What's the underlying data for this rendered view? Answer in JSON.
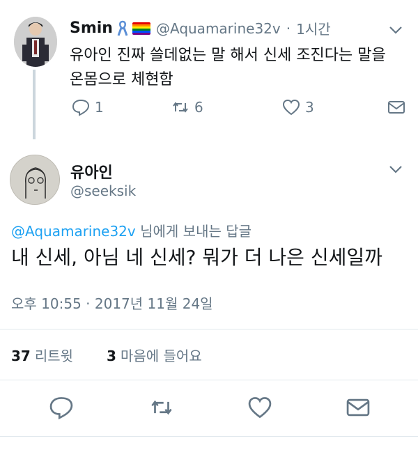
{
  "parent_tweet": {
    "display_name": "Smin",
    "handle": "@Aquamarine32v",
    "separator": "·",
    "time": "1시간",
    "text": "유아인 진짜 쓸데없는 말 해서 신세 조진다는 말을 온몸으로 체현함",
    "reply_count": "1",
    "retweet_count": "6",
    "like_count": "3",
    "icons": [
      "reply-icon",
      "retweet-icon",
      "like-icon",
      "message-icon",
      "chevron-down-icon",
      "ribbon-icon",
      "rainbow-flag-icon"
    ]
  },
  "main_tweet": {
    "display_name": "유아인",
    "handle": "@seeksik",
    "reply_to_handle": "@Aquamarine32v",
    "reply_to_suffix": " 님에게 보내는 답글",
    "text": "내 신세, 아님 네 신세? 뭐가 더 나은 신세일까",
    "timestamp": "오후 10:55 · 2017년 11월 24일",
    "retweets_num": "37",
    "retweets_label": "리트윗",
    "likes_num": "3",
    "likes_label": "마음에 들어요"
  },
  "colors": {
    "link": "#1da1f2",
    "muted": "#657786",
    "text": "#14171a",
    "divider": "#e1e8ed",
    "ribbon": "#5b8fd6"
  }
}
